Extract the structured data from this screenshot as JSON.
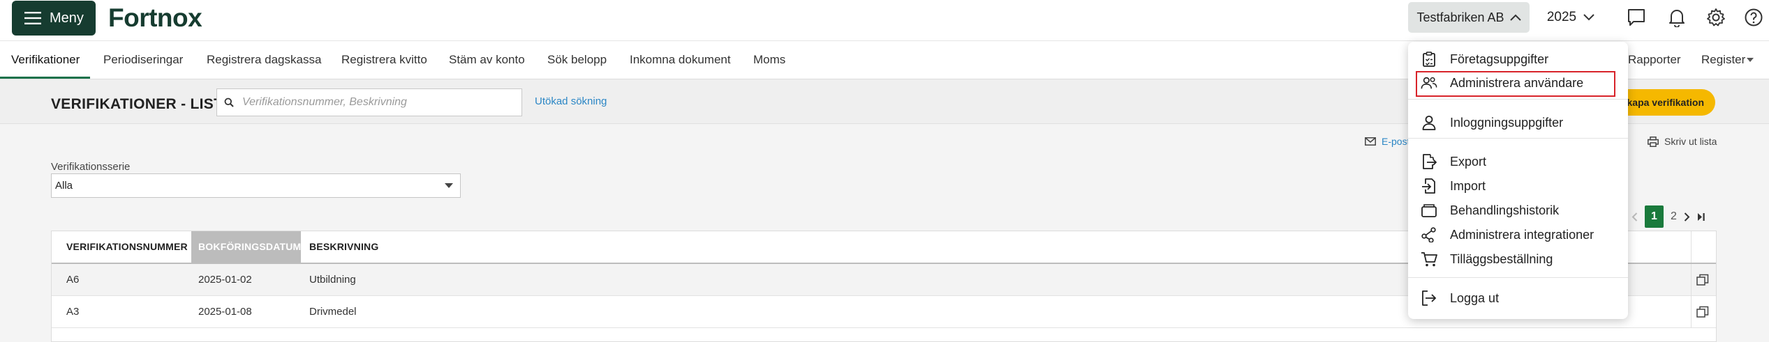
{
  "header": {
    "menu_label": "Meny",
    "logo_text": "Fortnox",
    "company": "Testfabriken AB",
    "year": "2025",
    "brand_color": "#163c30"
  },
  "nav": {
    "items": [
      "Verifikationer",
      "Periodiseringar",
      "Registrera dagskassa",
      "Registrera kvitto",
      "Stäm av konto",
      "Sök belopp",
      "Inkomna dokument",
      "Moms"
    ],
    "right_items": [
      "Rapporter",
      "Register"
    ],
    "active": "Verifikationer"
  },
  "page": {
    "title": "VERIFIKATIONER - LISTA",
    "search_placeholder": "Verifikationsnummer, Beskrivning",
    "advanced_search": "Utökad sökning",
    "create_button": "kapa verifikation",
    "email_link": "E-post",
    "print_link": "Skriv ut lista"
  },
  "filter": {
    "label": "Verifikationsserie",
    "selected": "Alla"
  },
  "pagination": {
    "pages": [
      "1",
      "2"
    ],
    "current": "1"
  },
  "table": {
    "columns": [
      "VERIFIKATIONSNUMMER",
      "BOKFÖRINGSDATUM",
      "BESKRIVNING"
    ],
    "sorted_column": "BOKFÖRINGSDATUM",
    "rows": [
      {
        "number": "A6",
        "date": "2025-01-02",
        "description": "Utbildning"
      },
      {
        "number": "A3",
        "date": "2025-01-08",
        "description": "Drivmedel"
      }
    ]
  },
  "dropdown": {
    "items": [
      {
        "label": "Företagsuppgifter",
        "icon": "clipboard-icon"
      },
      {
        "label": "Administrera användare",
        "icon": "users-icon",
        "highlighted": true
      },
      {
        "label": "Inloggningsuppgifter",
        "icon": "user-icon"
      },
      {
        "label": "Export",
        "icon": "export-icon"
      },
      {
        "label": "Import",
        "icon": "import-icon"
      },
      {
        "label": "Behandlingshistorik",
        "icon": "folder-icon"
      },
      {
        "label": "Administrera integrationer",
        "icon": "share-icon"
      },
      {
        "label": "Tilläggsbeställning",
        "icon": "cart-icon"
      },
      {
        "label": "Logga ut",
        "icon": "logout-icon"
      }
    ],
    "highlight_color": "#d8232a"
  }
}
